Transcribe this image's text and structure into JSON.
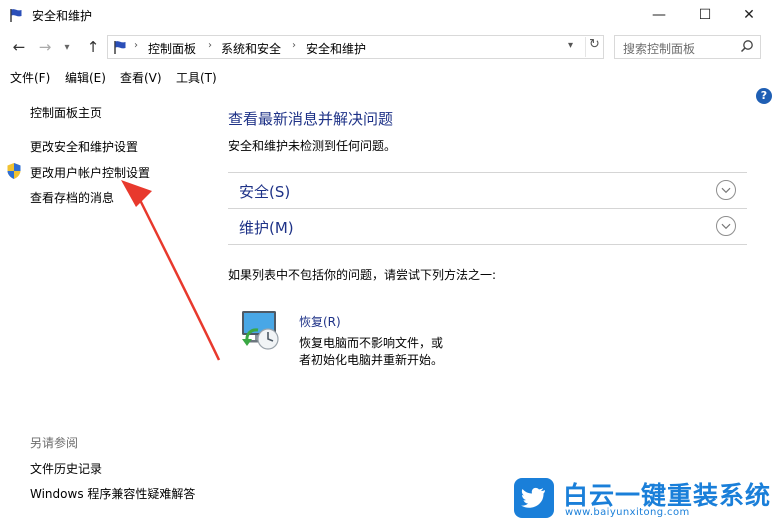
{
  "window": {
    "title": "安全和维护",
    "controls": {
      "minimize": "—",
      "maximize": "☐",
      "close": "✕"
    }
  },
  "nav": {
    "breadcrumb": [
      "控制面板",
      "系统和安全",
      "安全和维护"
    ],
    "search_placeholder": "搜索控制面板"
  },
  "menu": [
    "文件(F)",
    "编辑(E)",
    "查看(V)",
    "工具(T)"
  ],
  "left": {
    "links": [
      "控制面板主页",
      "更改安全和维护设置",
      "更改用户帐户控制设置",
      "查看存档的消息"
    ],
    "see_also_label": "另请参阅",
    "see_also_links": [
      "文件历史记录",
      "Windows 程序兼容性疑难解答"
    ]
  },
  "main": {
    "title": "查看最新消息并解决问题",
    "subtitle": "安全和维护未检测到任何问题。",
    "sections": [
      "安全(S)",
      "维护(M)"
    ],
    "try_text": "如果列表中不包括你的问题，请尝试下列方法之一:",
    "recovery": {
      "link": "恢复(R)",
      "desc_line1": "恢复电脑而不影响文件，或",
      "desc_line2": "者初始化电脑并重新开始。"
    }
  },
  "watermark": {
    "text": "白云一键重装系统",
    "url": "www.baiyunxitong.com"
  },
  "colors": {
    "link_blue": "#1e3287",
    "annotation_red": "#e8392d",
    "watermark_blue": "#1a7fd9"
  }
}
